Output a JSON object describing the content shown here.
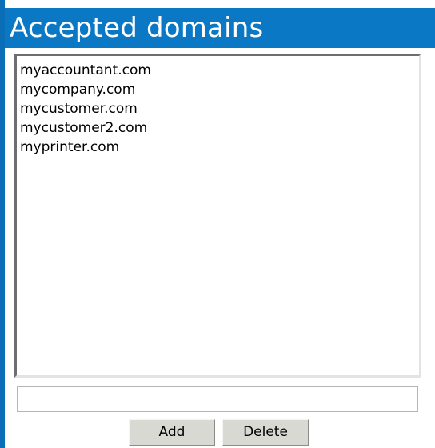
{
  "panel": {
    "title": "Accepted domains"
  },
  "domains": [
    "myaccountant.com",
    "mycompany.com",
    "mycustomer.com",
    "mycustomer2.com",
    "myprinter.com"
  ],
  "new_domain": {
    "value": "",
    "placeholder": ""
  },
  "buttons": {
    "add_label": "Add",
    "delete_label": "Delete"
  },
  "colors": {
    "title_bar": "#0a78c4",
    "left_edge": "#0a6fb6",
    "button_face": "#d9d9d3"
  }
}
